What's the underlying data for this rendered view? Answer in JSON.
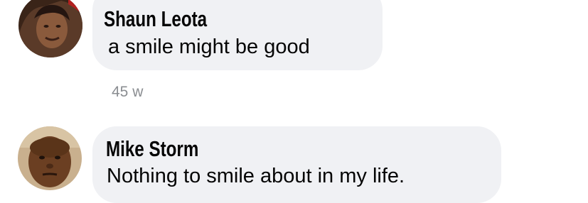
{
  "comments": [
    {
      "author": "Shaun Leota",
      "text": "a smile might be good",
      "time": "45 w",
      "avatar_icon": "user-avatar-photo"
    },
    {
      "author": "Mike Storm",
      "text": "Nothing to smile about in my life.",
      "avatar_icon": "user-avatar-photo"
    }
  ],
  "colors": {
    "bubble": "#f0f1f4",
    "text": "#050505",
    "timestamp": "#8a8d91"
  }
}
